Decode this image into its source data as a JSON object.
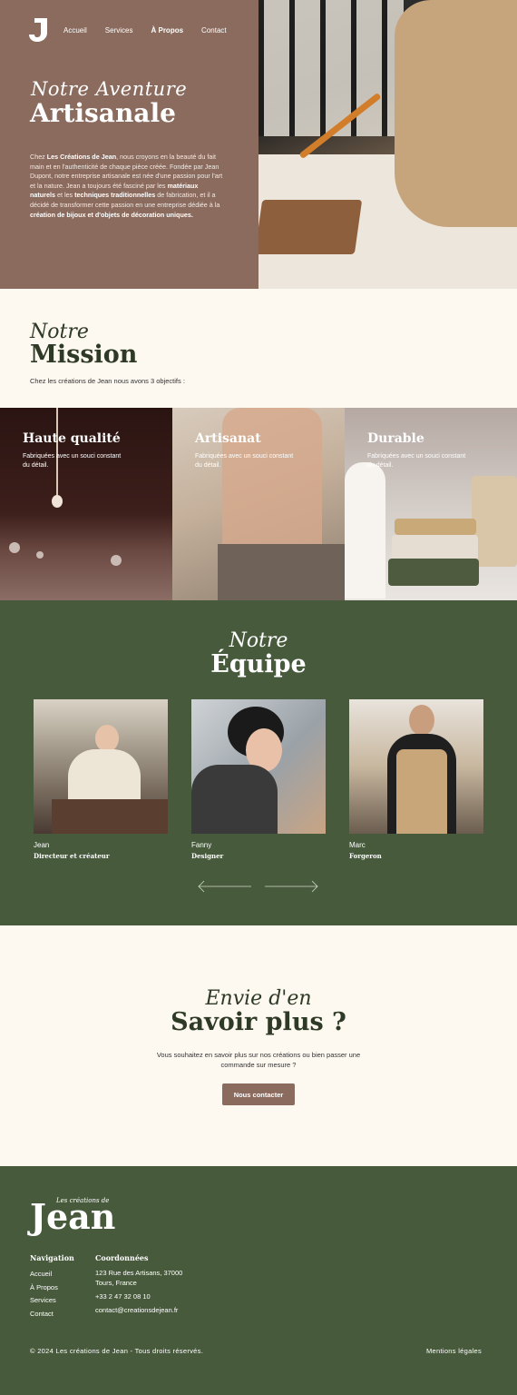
{
  "nav": {
    "items": [
      "Accueil",
      "Services",
      "À Propos",
      "Contact"
    ]
  },
  "hero": {
    "script": "Notre Aventure",
    "title": "Artisanale",
    "text": {
      "p1": "Chez ",
      "brand": "Les Créations de Jean",
      "p2": ", nous croyons en la beauté du fait main et en l'authenticité de chaque pièce créée. Fondée par Jean Dupont, notre entreprise artisanale est née d'une passion pour l'art et la nature. Jean a toujours été fasciné par les ",
      "b1": "matériaux naturels",
      "p3": " et les ",
      "b2": "techniques traditionnelles",
      "p4": " de fabrication, et il a décidé de transformer cette passion en une entreprise dédiée à la ",
      "b3": "création de bijoux et d'objets de décoration uniques."
    }
  },
  "mission": {
    "script": "Notre",
    "title": "Mission",
    "subtitle": "Chez les créations de Jean nous avons 3 objectifs :"
  },
  "objectives": [
    {
      "title": "Haute qualité",
      "text": "Fabriquées avec un souci constant du détail."
    },
    {
      "title": "Artisanat",
      "text": "Fabriquées avec un souci constant du détail."
    },
    {
      "title": "Durable",
      "text": "Fabriquées avec un souci constant du détail."
    }
  ],
  "team": {
    "script": "Notre",
    "title": "Équipe",
    "members": [
      {
        "name": "Jean",
        "role": "Directeur et créateur"
      },
      {
        "name": "Fanny",
        "role": "Designer"
      },
      {
        "name": "Marc",
        "role": "Forgeron"
      }
    ]
  },
  "cta": {
    "script": "Envie d'en",
    "title": "Savoir plus ?",
    "text": "Vous souhaitez en savoir plus sur nos créations ou bien passer une commande sur mesure ?",
    "button": "Nous contacter"
  },
  "footer": {
    "logo_small": "Les créations de",
    "logo_big": "Jean",
    "nav_title": "Navigation",
    "nav_links": [
      "Accueil",
      "À Propos",
      "Services",
      "Contact"
    ],
    "contact_title": "Coordonnées",
    "address_line1": "123 Rue des Artisans, 37000",
    "address_line2": "Tours, France",
    "phone": "+33 2 47 32 08 10",
    "email": "contact@creationsdejean.fr",
    "copyright": "© 2024 Les créations de Jean - Tous droits réservés.",
    "legal": "Mentions légales"
  },
  "colors": {
    "brown": "#8b6b5d",
    "green": "#475a3c",
    "cream": "#fdf8f0",
    "dark_green_text": "#2e3a26"
  }
}
